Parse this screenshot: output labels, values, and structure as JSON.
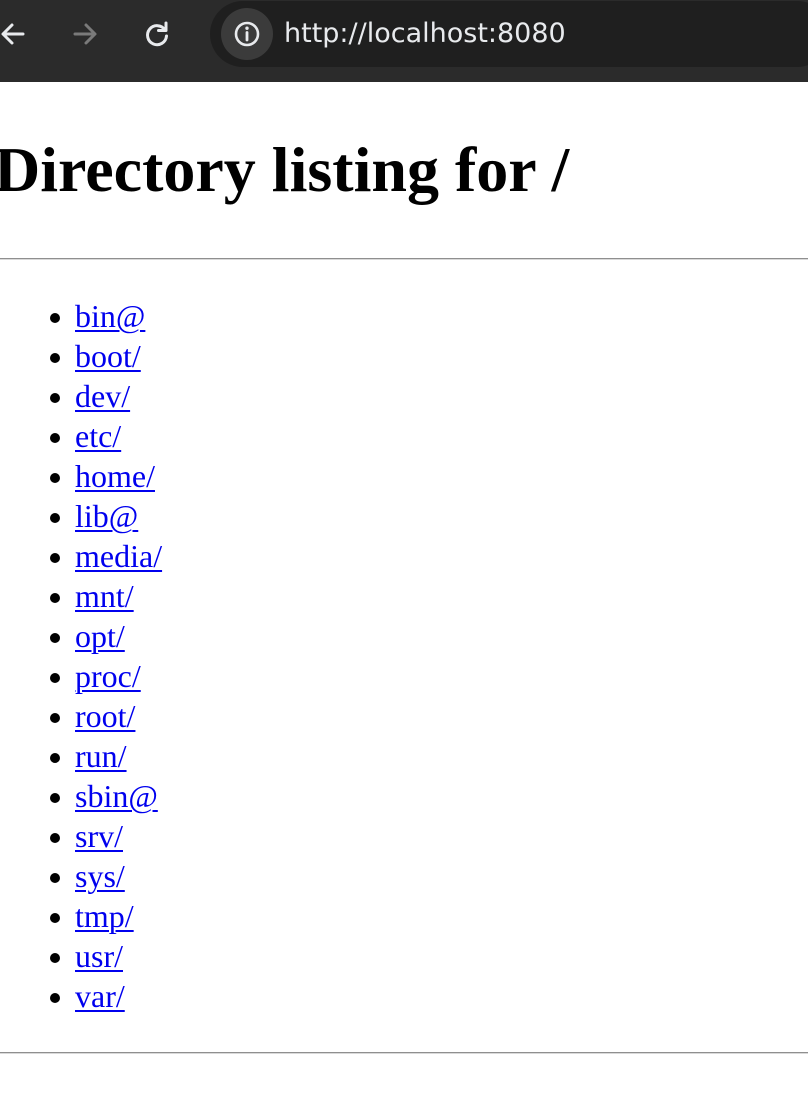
{
  "browser": {
    "url": "http://localhost:8080",
    "icons": {
      "back": "arrow-left-icon",
      "forward": "arrow-right-icon",
      "reload": "reload-icon",
      "site_info": "info-icon"
    },
    "colors": {
      "toolbar": "#2b2b2b",
      "address_bar": "#1f1f1f",
      "url_text": "#e8eaed"
    }
  },
  "page": {
    "title": "Directory listing for /",
    "link_color": "#0000ee",
    "entries": [
      "bin@",
      "boot/",
      "dev/",
      "etc/",
      "home/",
      "lib@",
      "media/",
      "mnt/",
      "opt/",
      "proc/",
      "root/",
      "run/",
      "sbin@",
      "srv/",
      "sys/",
      "tmp/",
      "usr/",
      "var/"
    ]
  }
}
